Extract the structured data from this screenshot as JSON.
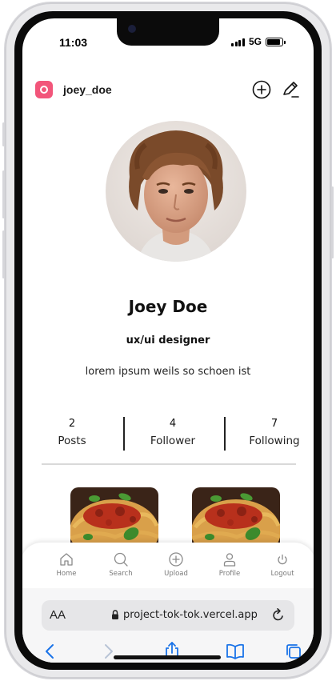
{
  "status_bar": {
    "time": "11:03",
    "network": "5G",
    "battery_level": 0.9
  },
  "header": {
    "username": "joey_doe",
    "add_icon": "plus-circle-icon",
    "edit_icon": "pencil-icon"
  },
  "profile": {
    "name": "Joey Doe",
    "role": "ux/ui designer",
    "bio": "lorem ipsum weils so schoen ist"
  },
  "stats": [
    {
      "value": "2",
      "label": "Posts"
    },
    {
      "value": "4",
      "label": "Follower"
    },
    {
      "value": "7",
      "label": "Following"
    }
  ],
  "tabs": [
    {
      "label": "Home",
      "icon": "home-icon"
    },
    {
      "label": "Search",
      "icon": "search-icon"
    },
    {
      "label": "Upload",
      "icon": "upload-icon"
    },
    {
      "label": "Profile",
      "icon": "profile-icon"
    },
    {
      "label": "Logout",
      "icon": "power-icon"
    }
  ],
  "browser": {
    "text_size_button": "AA",
    "url": "project-tok-tok.vercel.app"
  },
  "colors": {
    "brand": "#f2557a",
    "divider": "#d9d9d9",
    "tab_label": "#7a7a7a",
    "safari_blue": "#1a73e8"
  }
}
